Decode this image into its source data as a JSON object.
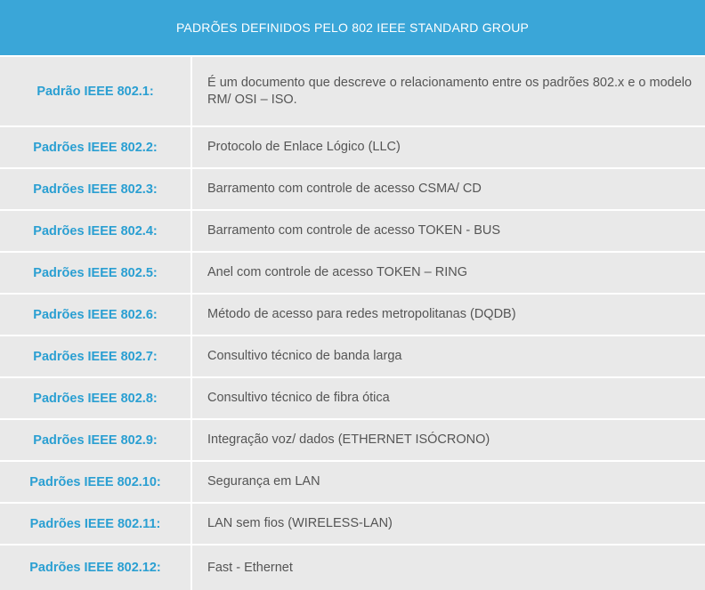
{
  "header": {
    "title": "PADRÕES DEFINIDOS PELO 802 IEEE STANDARD GROUP"
  },
  "rows": [
    {
      "label": "Padrão IEEE 802.1:",
      "description": "É um documento que descreve o relacionamento entre os padrões 802.x e o modelo RM/ OSI – ISO."
    },
    {
      "label": "Padrões IEEE 802.2:",
      "description": "Protocolo de Enlace Lógico (LLC)"
    },
    {
      "label": "Padrões IEEE 802.3:",
      "description": "Barramento com controle de acesso CSMA/ CD"
    },
    {
      "label": "Padrões IEEE 802.4:",
      "description": "Barramento com controle de acesso TOKEN - BUS"
    },
    {
      "label": "Padrões IEEE 802.5:",
      "description": "Anel com controle de acesso TOKEN – RING"
    },
    {
      "label": "Padrões IEEE 802.6:",
      "description": "Método de acesso para redes metropolitanas (DQDB)"
    },
    {
      "label": "Padrões IEEE 802.7:",
      "description": "Consultivo técnico de banda larga"
    },
    {
      "label": "Padrões IEEE 802.8:",
      "description": "Consultivo técnico de fibra ótica"
    },
    {
      "label": "Padrões IEEE 802.9:",
      "description": "Integração voz/ dados (ETHERNET ISÓCRONO)"
    },
    {
      "label": "Padrões IEEE 802.10:",
      "description": "Segurança em LAN"
    },
    {
      "label": "Padrões IEEE 802.11:",
      "description": "LAN sem fios (WIRELESS-LAN)"
    },
    {
      "label": "Padrões IEEE 802.12:",
      "description": "Fast - Ethernet"
    }
  ],
  "colors": {
    "header_bg": "#3aa6d8",
    "label_text": "#2a9fd2",
    "row_bg": "#e9e9e9",
    "desc_text": "#555555"
  }
}
